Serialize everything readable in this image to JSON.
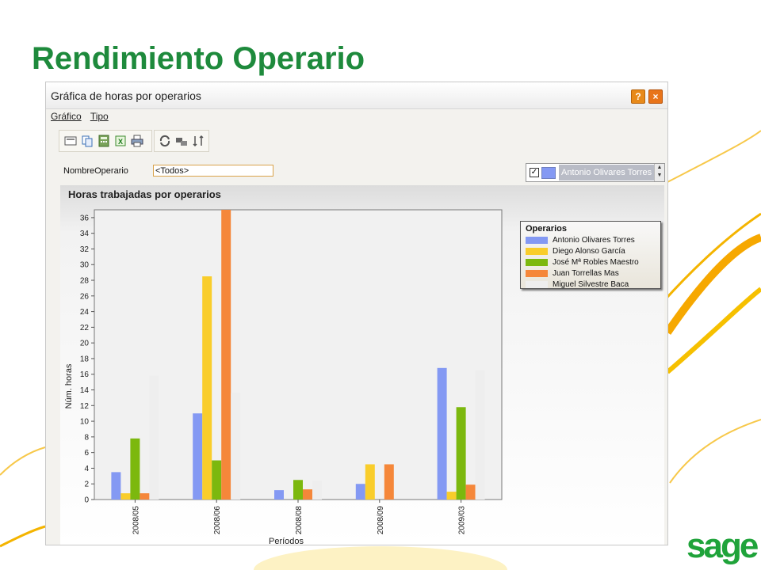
{
  "slide": {
    "title": "Rendimiento Operario",
    "logo": "sage"
  },
  "window": {
    "title": "Gráfica de horas por operarios",
    "help_label": "?",
    "close_label": "×",
    "menu": [
      "Gráfico",
      "Tipo"
    ],
    "toolbar_icons": [
      "view-icon",
      "copy-icon",
      "calculator-icon",
      "export-excel-icon",
      "print-icon",
      "refresh-icon",
      "chart-switch-icon",
      "rotate-icon"
    ]
  },
  "filter": {
    "label": "NombreOperario",
    "value": "<Todos>"
  },
  "series_selector": {
    "checked": "✓",
    "selected": "Antonio Olivares Torres"
  },
  "chart_data": {
    "type": "bar",
    "title": "Horas trabajadas por operarios",
    "xlabel": "Períodos",
    "ylabel": "Núm. horas",
    "ylim": [
      0,
      37
    ],
    "yticks": [
      0,
      2,
      4,
      6,
      8,
      10,
      12,
      14,
      16,
      18,
      20,
      22,
      24,
      26,
      28,
      30,
      32,
      34,
      36
    ],
    "categories": [
      "2008/05",
      "2008/06",
      "2008/08",
      "2008/09",
      "2009/03"
    ],
    "legend_title": "Operarios",
    "legend_position": "top-right",
    "series": [
      {
        "name": "Antonio Olivares Torres",
        "color": "#8499f3",
        "values": [
          3.5,
          11,
          1.2,
          2,
          16.8
        ]
      },
      {
        "name": "Diego Alonso García",
        "color": "#f9cd2b",
        "values": [
          0.8,
          28.5,
          0,
          4.5,
          1
        ]
      },
      {
        "name": "José Mª Robles Maestro",
        "color": "#7cb80e",
        "values": [
          7.8,
          5,
          2.5,
          0,
          11.8
        ]
      },
      {
        "name": "Juan Torrellas Mas",
        "color": "#f5873a",
        "values": [
          0.8,
          37.5,
          1.3,
          4.5,
          1.9
        ]
      },
      {
        "name": "Miguel Silvestre Baca",
        "color": "#eeeeee",
        "values": [
          15.8,
          13.6,
          2.4,
          0,
          16.5
        ]
      }
    ]
  }
}
